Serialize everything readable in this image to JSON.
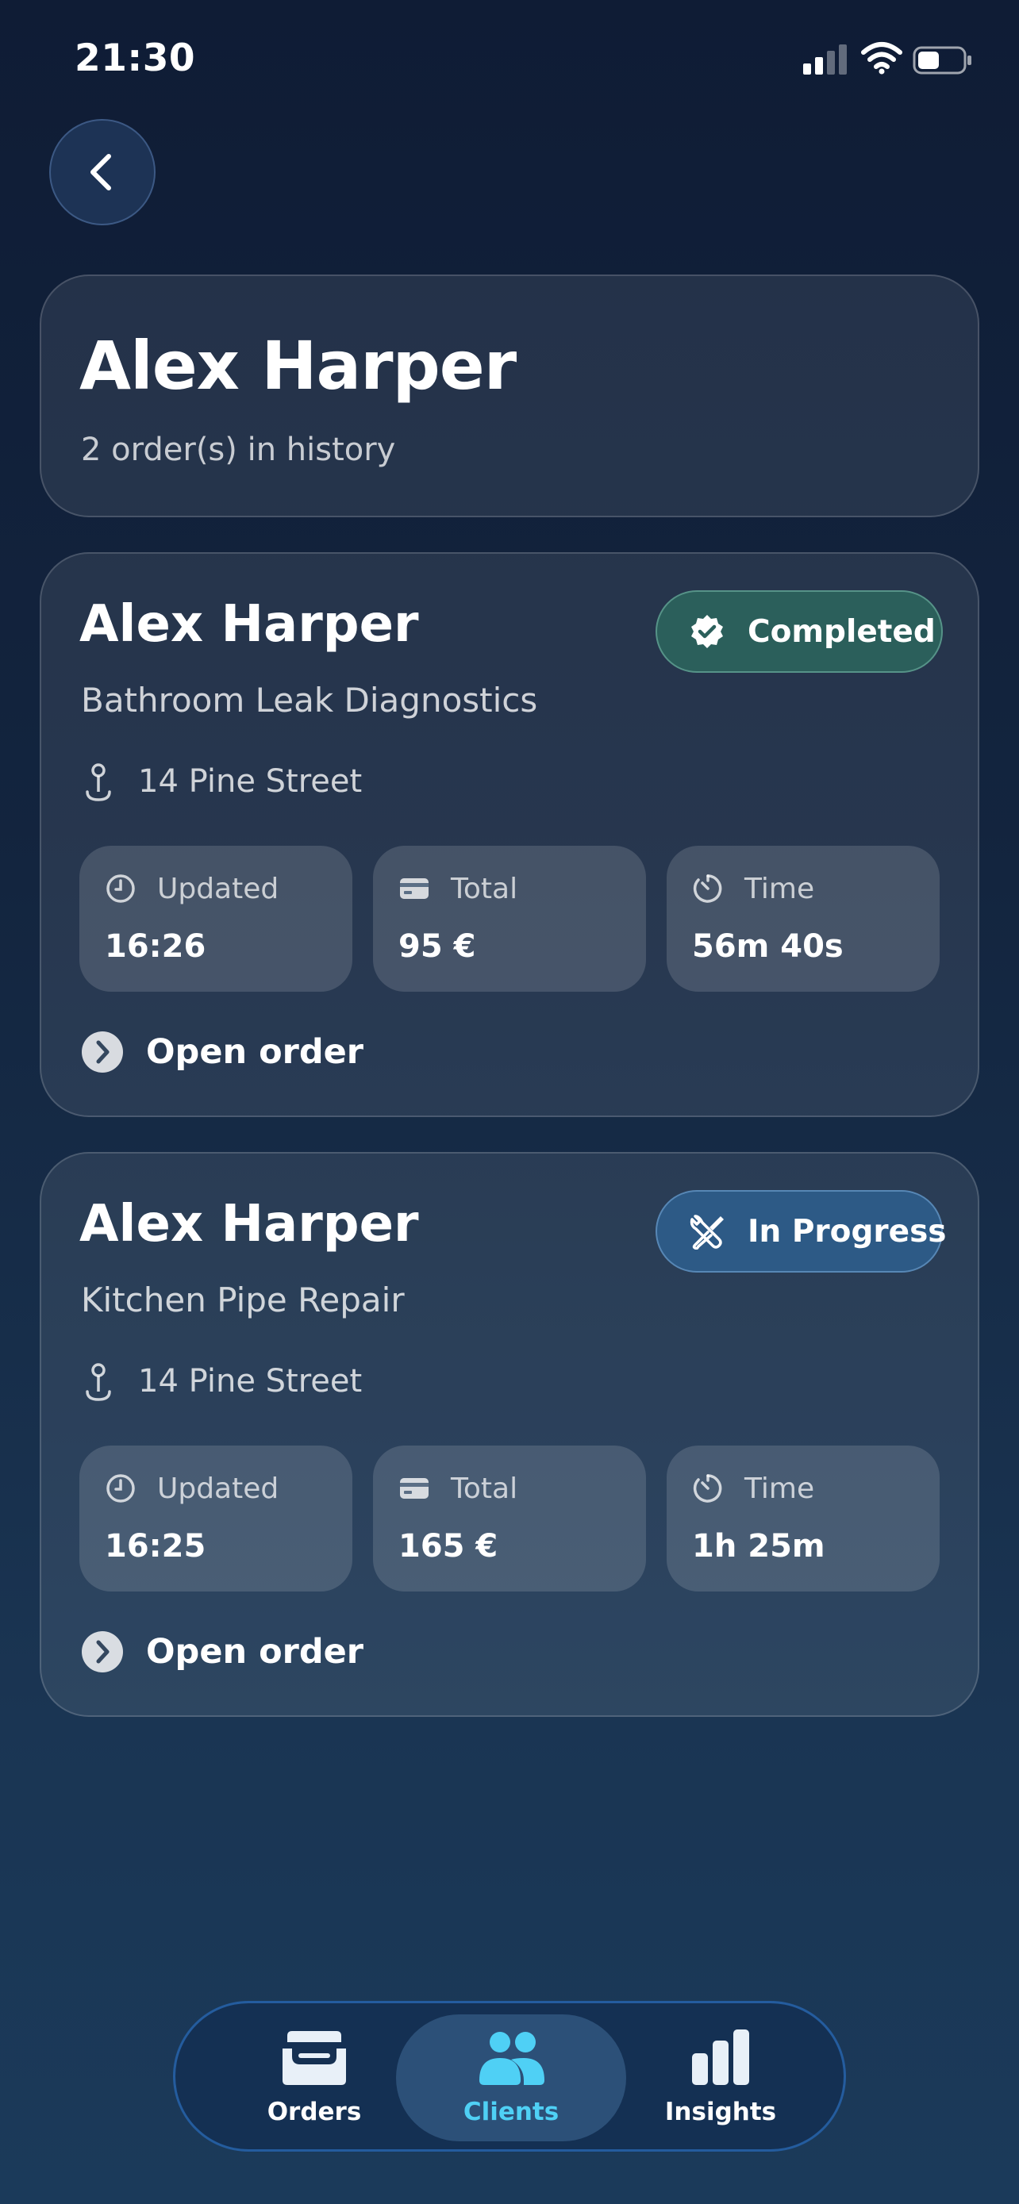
{
  "status_bar": {
    "time": "21:30",
    "signal_icon": "cellular-signal-icon",
    "wifi_icon": "wifi-icon",
    "battery_icon": "battery-icon"
  },
  "back_button": {
    "icon": "chevron-left-icon"
  },
  "client_header": {
    "name": "Alex Harper",
    "order_count_text": "2 order(s) in history"
  },
  "orders": [
    {
      "client_name": "Alex Harper",
      "service": "Bathroom Leak Diagnostics",
      "address": "14 Pine Street",
      "status": {
        "label": "Completed",
        "icon": "verified-check-icon",
        "color": "#2b5f5b"
      },
      "stats": {
        "updated": {
          "label": "Updated",
          "value": "16:26",
          "icon": "clock-icon"
        },
        "total": {
          "label": "Total",
          "value": "95 €",
          "icon": "credit-card-icon"
        },
        "time": {
          "label": "Time",
          "value": "56m 40s",
          "icon": "timer-icon"
        }
      },
      "open_label": "Open order"
    },
    {
      "client_name": "Alex Harper",
      "service": "Kitchen Pipe Repair",
      "address": "14 Pine Street",
      "status": {
        "label": "In Progress",
        "icon": "wrench-screwdriver-icon",
        "color": "#2d5a86"
      },
      "stats": {
        "updated": {
          "label": "Updated",
          "value": "16:25",
          "icon": "clock-icon"
        },
        "total": {
          "label": "Total",
          "value": "165 €",
          "icon": "credit-card-icon"
        },
        "time": {
          "label": "Time",
          "value": "1h 25m",
          "icon": "timer-icon"
        }
      },
      "open_label": "Open order"
    }
  ],
  "tab_bar": {
    "tabs": [
      {
        "label": "Orders",
        "icon": "inbox-tray-icon",
        "selected": false
      },
      {
        "label": "Clients",
        "icon": "people-icon",
        "selected": true
      },
      {
        "label": "Insights",
        "icon": "bar-chart-icon",
        "selected": false
      }
    ],
    "accent_color": "#4fd0f5"
  }
}
